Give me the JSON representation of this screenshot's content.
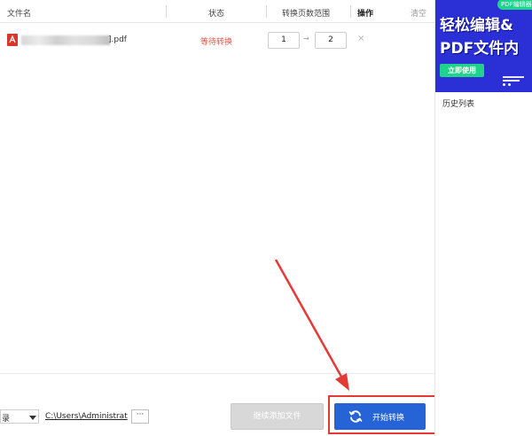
{
  "table": {
    "headers": {
      "filename": "文件名",
      "status": "状态",
      "page_range": "转换页数范围",
      "action": "操作",
      "clear": "清空"
    }
  },
  "files": [
    {
      "name_suffix": "].pdf",
      "status": "等待转换",
      "page_from": "1",
      "page_to": "2",
      "arrow": "→",
      "delete": "×"
    }
  ],
  "sidebar": {
    "ad": {
      "tag": "PDF编辑器",
      "line1": "轻松编辑&",
      "line2": "PDF文件内",
      "button": "立即使用"
    },
    "history_label": "历史列表"
  },
  "bottom": {
    "output_dir_label": "录",
    "output_path": "C:\\Users\\Administrat",
    "browse_label": "···",
    "add_files_label": "继续添加文件",
    "start_label": "开始转换"
  },
  "colors": {
    "primary": "#2563d6",
    "status_waiting": "#e05a4a",
    "ad_bg": "#2a2fd6",
    "ad_accent": "#1fd38a",
    "highlight": "#e53935",
    "pdf_icon": "#d9362b"
  }
}
